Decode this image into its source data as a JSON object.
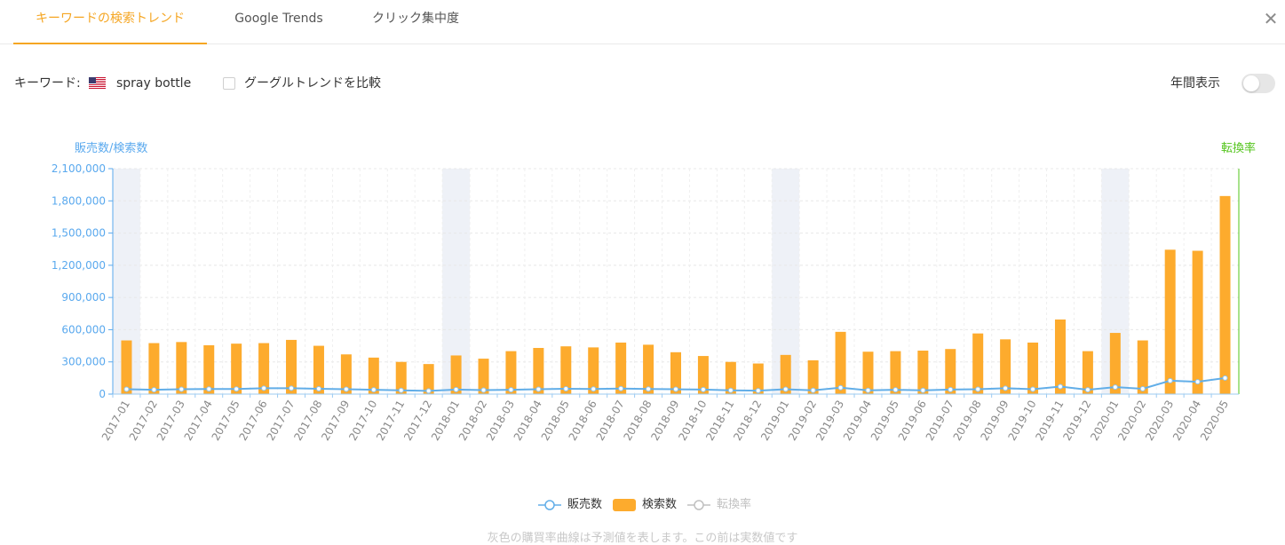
{
  "tabs": [
    {
      "label": "キーワードの検索トレンド",
      "active": true
    },
    {
      "label": "Google Trends",
      "active": false
    },
    {
      "label": "クリック集中度",
      "active": false
    }
  ],
  "close_icon": "close-icon",
  "keyword_row": {
    "label": "キーワード:",
    "flag_icon": "us-flag-icon",
    "keyword": "spray bottle",
    "compare_label": "グーグルトレンドを比較",
    "compare_checked": false,
    "annual_label": "年間表示",
    "annual_on": false
  },
  "legend": {
    "sales": "販売数",
    "search": "検索数",
    "conversion": "転換率"
  },
  "footnote": "灰色の購買率曲線は予測値を表します。この前は実数値です",
  "colors": {
    "accent": "#f5a623",
    "bar": "#fdab2d",
    "sales_line": "#62aee8",
    "left_axis": "#5aa9ee",
    "right_axis": "#52c41a",
    "shade": "#eef1f7",
    "legend_disabled": "#c0c0c0"
  },
  "chart_data": {
    "type": "bar",
    "y_left_label": "販売数/検索数",
    "y_right_label": "転換率",
    "y_ticks": [
      "0",
      "300,000",
      "600,000",
      "900,000",
      "1,200,000",
      "1,500,000",
      "1,800,000",
      "2,100,000"
    ],
    "ylim": [
      0,
      2100000
    ],
    "grid": true,
    "legend_position": "bottom",
    "shaded_months": [
      "2017-01",
      "2018-01",
      "2019-01",
      "2020-01"
    ],
    "categories": [
      "2017-01",
      "2017-02",
      "2017-03",
      "2017-04",
      "2017-05",
      "2017-06",
      "2017-07",
      "2017-08",
      "2017-09",
      "2017-10",
      "2017-11",
      "2017-12",
      "2018-01",
      "2018-02",
      "2018-03",
      "2018-04",
      "2018-05",
      "2018-06",
      "2018-07",
      "2018-08",
      "2018-09",
      "2018-10",
      "2018-11",
      "2018-12",
      "2019-01",
      "2019-02",
      "2019-03",
      "2019-04",
      "2019-05",
      "2019-06",
      "2019-07",
      "2019-08",
      "2019-09",
      "2019-10",
      "2019-11",
      "2019-12",
      "2020-01",
      "2020-02",
      "2020-03",
      "2020-04",
      "2020-05"
    ],
    "series": [
      {
        "name": "検索数",
        "type": "bar",
        "values": [
          500000,
          475000,
          485000,
          455000,
          470000,
          475000,
          505000,
          450000,
          370000,
          340000,
          300000,
          280000,
          360000,
          330000,
          400000,
          430000,
          445000,
          435000,
          480000,
          460000,
          390000,
          355000,
          300000,
          285000,
          365000,
          315000,
          580000,
          395000,
          400000,
          405000,
          420000,
          565000,
          510000,
          480000,
          695000,
          400000,
          570000,
          500000,
          1345000,
          1335000,
          1845000
        ]
      },
      {
        "name": "販売数",
        "type": "line",
        "values": [
          45000,
          40000,
          45000,
          48000,
          48000,
          55000,
          55000,
          50000,
          45000,
          40000,
          35000,
          30000,
          42000,
          37000,
          40000,
          45000,
          50000,
          48000,
          52000,
          48000,
          45000,
          42000,
          35000,
          32000,
          45000,
          35000,
          60000,
          35000,
          40000,
          35000,
          42000,
          45000,
          55000,
          45000,
          70000,
          40000,
          65000,
          50000,
          125000,
          115000,
          150000
        ]
      },
      {
        "name": "転換率",
        "type": "line",
        "values": []
      }
    ]
  }
}
